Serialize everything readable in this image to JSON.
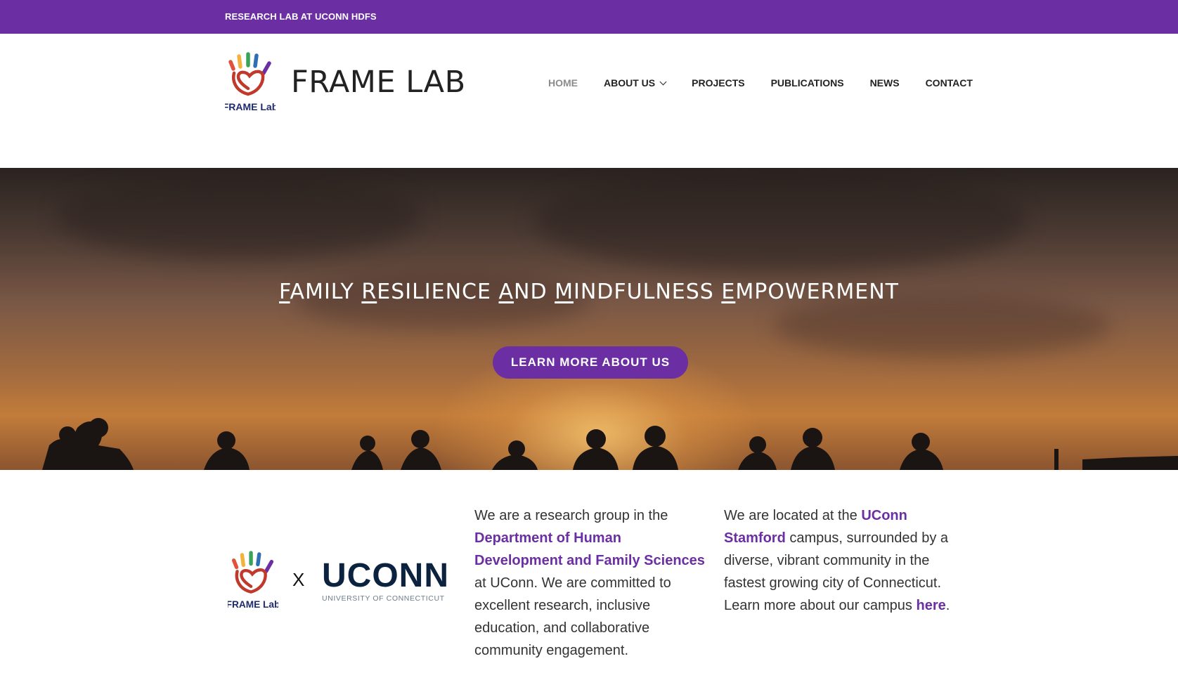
{
  "topbar": {
    "text": "RESEARCH LAB AT UCONN HDFS"
  },
  "header": {
    "logo_text": "FRAME Lab",
    "site_title": "FRAME LAB",
    "nav": [
      {
        "label": "HOME",
        "active": true
      },
      {
        "label": "ABOUT US",
        "has_dropdown": true
      },
      {
        "label": "PROJECTS"
      },
      {
        "label": "PUBLICATIONS"
      },
      {
        "label": "NEWS"
      },
      {
        "label": "CONTACT"
      }
    ]
  },
  "hero": {
    "title_letters": [
      "F",
      "R",
      "A",
      "M",
      "E"
    ],
    "title_rest": [
      "AMILY ",
      "ESILIENCE ",
      "ND ",
      "INDFULNESS ",
      "MPOWERMENT"
    ],
    "button_label": "LEARN MORE ABOUT US"
  },
  "about": {
    "logo_text": "FRAME Lab",
    "x_mark": "X",
    "uconn_word": "UCONN",
    "uconn_sub": "UNIVERSITY OF CONNECTICUT",
    "col1": {
      "pre": "We are a research group in the ",
      "link": "Department of Human Development and Family Sciences",
      "post": " at UConn. We are committed to excellent research, inclusive education, and collaborative community engagement."
    },
    "col2": {
      "pre": "We are located at the ",
      "link": "UConn Stamford",
      "mid": " campus, surrounded by a diverse, vibrant community in the fastest growing city of Connecticut. Learn more about our campus ",
      "link2": "here",
      "post": "."
    }
  },
  "colors": {
    "brand_purple": "#6b2fa3",
    "navy": "#0c2340",
    "finger_colors": [
      "#f2b33d",
      "#3aa35a",
      "#2f6fb5",
      "#6b2fa3"
    ],
    "heart_red": "#c0392b"
  }
}
